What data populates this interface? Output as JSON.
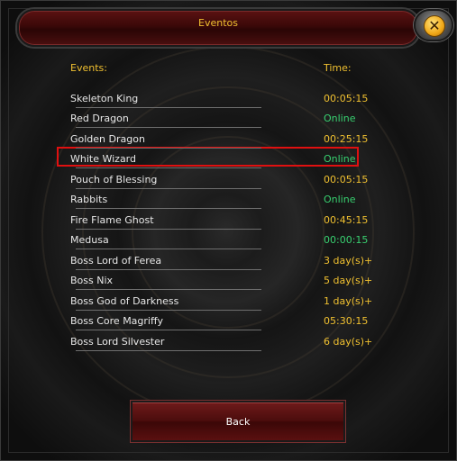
{
  "window": {
    "title": "Eventos",
    "close_label": "✕",
    "back_label": "Back"
  },
  "headers": {
    "events": "Events:",
    "time": "Time:"
  },
  "events": [
    {
      "name": "Skeleton King",
      "time": "00:05:15",
      "color": "#f0c030"
    },
    {
      "name": "Red Dragon",
      "time": "Online",
      "color": "#38d070"
    },
    {
      "name": "Golden Dragon",
      "time": "00:25:15",
      "color": "#f0c030"
    },
    {
      "name": "White Wizard",
      "time": "Online",
      "color": "#38d070"
    },
    {
      "name": "Pouch of Blessing",
      "time": "00:05:15",
      "color": "#f0c030"
    },
    {
      "name": "Rabbits",
      "time": "Online",
      "color": "#38d070"
    },
    {
      "name": "Fire Flame Ghost",
      "time": "00:45:15",
      "color": "#f0c030"
    },
    {
      "name": "Medusa",
      "time": "00:00:15",
      "color": "#38d070"
    },
    {
      "name": "Boss Lord of Ferea",
      "time": "3 day(s)+",
      "color": "#f0c030"
    },
    {
      "name": "Boss Nix",
      "time": "5 day(s)+",
      "color": "#f0c030"
    },
    {
      "name": "Boss God of Darkness",
      "time": "1 day(s)+",
      "color": "#f0c030"
    },
    {
      "name": "Boss Core Magriffy",
      "time": "05:30:15",
      "color": "#f0c030"
    },
    {
      "name": "Boss Lord Silvester",
      "time": "6 day(s)+",
      "color": "#f0c030"
    }
  ],
  "highlighted_event": "White Wizard"
}
